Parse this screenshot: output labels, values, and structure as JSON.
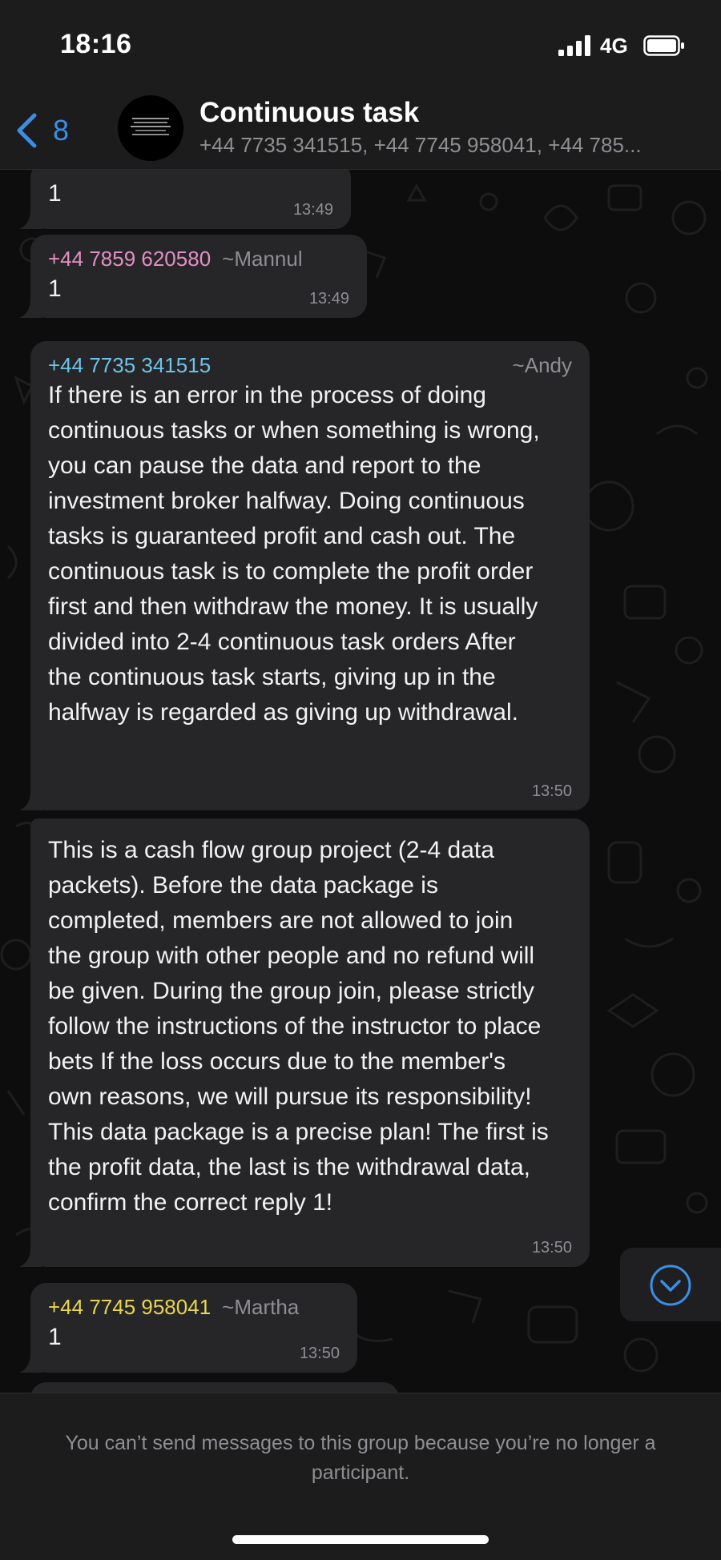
{
  "status_bar": {
    "time": "18:16",
    "network": "4G",
    "icons": [
      "signal-icon",
      "battery-icon"
    ]
  },
  "header": {
    "back_count": "8",
    "title": "Continuous task",
    "members": "+44 7735 341515, +44 7745 958041, +44 785..."
  },
  "colors": {
    "accent_blue": "#3a8ee6",
    "sender_pink": "#e48fc4",
    "sender_cyan": "#6ec3e8",
    "sender_yellow": "#e8d64e",
    "bubble_bg": "#262628"
  },
  "messages": [
    {
      "sender_phone": "",
      "sender_alias": "",
      "text": "1",
      "time": "13:49"
    },
    {
      "sender_phone": "+44 7859 620580",
      "sender_alias": "~Mannul",
      "text": "1",
      "time": "13:49"
    },
    {
      "sender_phone": "+44 7735 341515",
      "sender_alias": "~Andy",
      "text": "If there is an error in the process of doing continuous tasks or when something is wrong, you can pause the data and report to the investment broker halfway. Doing continuous tasks is guaranteed profit and cash out. The continuous task is to complete the profit order first and then withdraw the money. It is usually divided into 2-4 continuous task orders  After the continuous task starts, giving up in the halfway is regarded as giving up withdrawal.",
      "time": "13:50"
    },
    {
      "sender_phone": "",
      "sender_alias": "",
      "text": "This is a cash flow group project (2-4 data packets). Before the data package is completed, members are not allowed to join the group with other people and no refund will be given. During the group join, please strictly follow the instructions of the instructor to place bets If the loss occurs due to the member's own reasons, we will pursue its responsibility! This data package is a precise plan! The first is the profit data, the last is the withdrawal data, confirm the correct reply 1!",
      "time": "13:50"
    },
    {
      "sender_phone": "+44 7745 958041",
      "sender_alias": "~Martha",
      "text": "1",
      "time": "13:50"
    }
  ],
  "footer": {
    "notice": "You can’t send messages to this group because you’re no longer a participant."
  }
}
